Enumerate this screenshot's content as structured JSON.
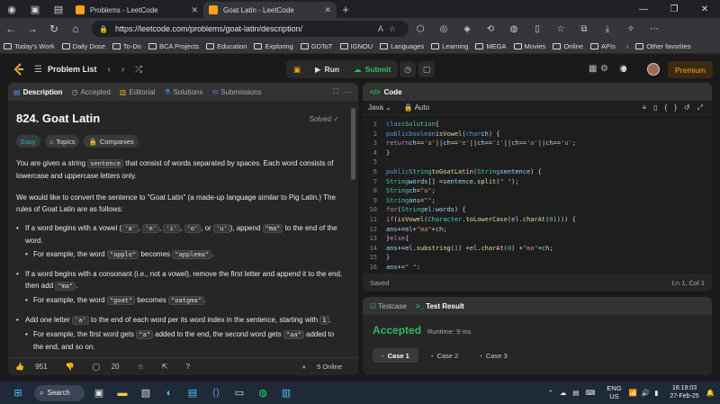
{
  "browser": {
    "tabs": [
      {
        "title": "Problems - LeetCode"
      },
      {
        "title": "Goat Latin - LeetCode"
      }
    ],
    "url": "https://leetcode.com/problems/goat-latin/description/"
  },
  "bookmarks": [
    "Today's Work",
    "Daily Dose",
    "To-Do",
    "BCA Projects",
    "Education",
    "Exploring",
    "GDToT",
    "IGNOU",
    "Languages",
    "Learning",
    "MEGA",
    "Movies",
    "Online",
    "APIs",
    "Other favorites"
  ],
  "nav": {
    "problem_list": "Problem List",
    "run": "Run",
    "submit": "Submit",
    "streak": "0",
    "premium": "Premium"
  },
  "left": {
    "tabs": [
      "Description",
      "Accepted",
      "Editorial",
      "Solutions",
      "Submissions"
    ],
    "title": "824. Goat Latin",
    "solved": "Solved",
    "chips": [
      "Easy",
      "Topics",
      "Companies"
    ],
    "p1a": "You are given a string ",
    "p1code": "sentence",
    "p1b": " that consist of words separated by spaces. Each word consists of lowercase and uppercase letters only.",
    "p2": "We would like to convert the sentence to \"Goat Latin\" (a made-up language similar to Pig Latin.) The rules of Goat Latin are as follows:",
    "r1a": "If a word begins with a vowel (",
    "r1v": [
      "'a'",
      "'e'",
      "'i'",
      "'o'",
      "'u'"
    ],
    "r1b": "), append ",
    "r1c": "\"ma\"",
    "r1d": " to the end of the word.",
    "r1ex_a": "For example, the word ",
    "r1ex_b": "\"apple\"",
    "r1ex_c": " becomes ",
    "r1ex_d": "\"applema\"",
    "r2a": "If a word begins with a consonant (i.e., not a vowel), remove the first letter and append it to the end, then add ",
    "r2b": "\"ma\"",
    "r2c": ".",
    "r2ex_a": "For example, the word ",
    "r2ex_b": "\"goat\"",
    "r2ex_c": " becomes ",
    "r2ex_d": "\"oatgma\"",
    "r3a": "Add one letter ",
    "r3b": "'a'",
    "r3c": " to the end of each word per its word index in the sentence, starting with ",
    "r3d": "1",
    "r3ex_a": "For example, the first word gets ",
    "r3ex_b": "\"a\"",
    "r3ex_c": " added to the end, the second word gets ",
    "r3ex_d": "\"aa\"",
    "r3ex_e": "added to the end, and so on.",
    "likes": "951",
    "comments": "20",
    "online": "5 Online"
  },
  "editor": {
    "title": "Code",
    "language": "Java",
    "mode": "Auto",
    "saved": "Saved",
    "cursor": "Ln 1, Col 1"
  },
  "test": {
    "tab1": "Testcase",
    "tab2": "Test Result",
    "status": "Accepted",
    "runtime": "Runtime: 9 ms",
    "cases": [
      "Case 1",
      "Case 2",
      "Case 3"
    ]
  },
  "taskbar": {
    "search": "Search",
    "lang": "ENG",
    "region": "US",
    "time": "16:19:03",
    "date": "27-Feb-25"
  }
}
